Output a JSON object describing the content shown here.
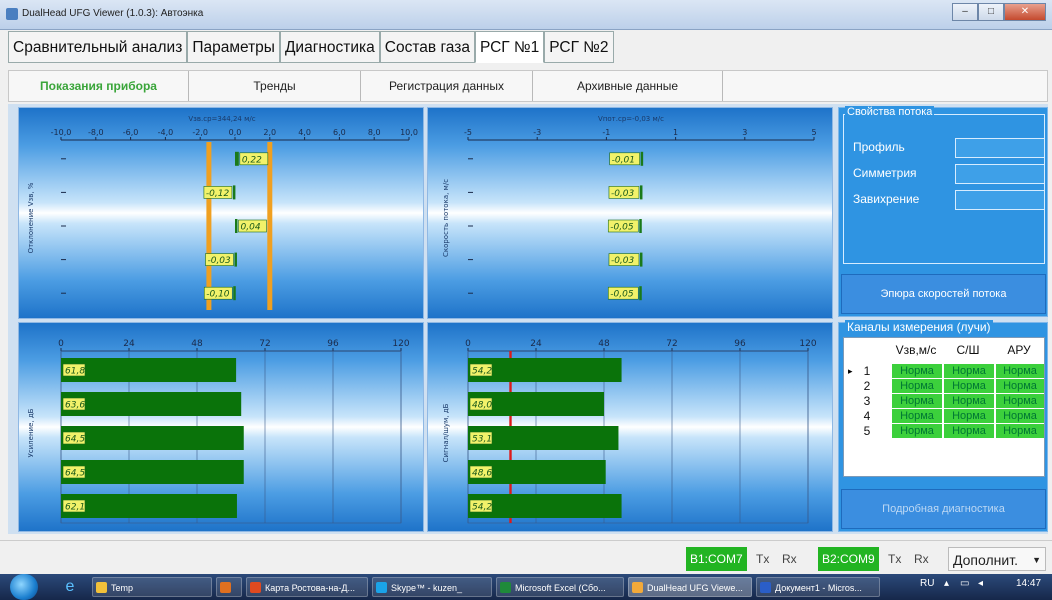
{
  "window": {
    "title": "DualHead UFG Viewer (1.0.3): Автоэнка",
    "btn_min": "–",
    "btn_max": "□",
    "btn_close": "✕"
  },
  "main_tabs": [
    {
      "label": "Сравнительный анализ"
    },
    {
      "label": "Параметры"
    },
    {
      "label": "Диагностика"
    },
    {
      "label": "Состав газа"
    },
    {
      "label": "РСГ №1",
      "active": true
    },
    {
      "label": "РСГ №2"
    }
  ],
  "sub_tabs": [
    {
      "label": "Показания прибора",
      "active": true
    },
    {
      "label": "Тренды"
    },
    {
      "label": "Регистрация данных"
    },
    {
      "label": "Архивные данные"
    }
  ],
  "charts": {
    "c1": {
      "title": "Vзв.ср=344,24 м/с",
      "ylabel": "Отклонение Vзв, %"
    },
    "c2": {
      "title": "Vпот.ср=-0,03 м/с",
      "ylabel": "Скорость потока, м/с"
    },
    "c3": {
      "ylabel": "Усиление, дБ"
    },
    "c4": {
      "ylabel": "Сигнал/шум, дБ"
    }
  },
  "chart_data": [
    {
      "type": "bar",
      "orientation": "horizontal",
      "title": "Vзв.ср=344,24 м/с",
      "ylabel": "Отклонение Vзв, %",
      "xticks": [
        "-10,0",
        "-8,0",
        "-6,0",
        "-4,0",
        "-2,0",
        "0,0",
        "2,0",
        "4,0",
        "6,0",
        "8,0",
        "10,0"
      ],
      "xlim": [
        -10,
        10
      ],
      "labels": [
        "0,22",
        "-0,12",
        "0,04",
        "-0,03",
        "-0,10"
      ],
      "values": [
        0.22,
        -0.12,
        0.04,
        -0.03,
        -0.1
      ],
      "limits": [
        -1.5,
        2.0
      ],
      "colors": {
        "bar": "#1a7a1a",
        "label": "#f2f26a",
        "limit": "#f0a020"
      }
    },
    {
      "type": "bar",
      "orientation": "horizontal",
      "title": "Vпот.ср=-0,03 м/с",
      "ylabel": "Скорость потока, м/с",
      "xticks": [
        "-5",
        "-3",
        "-1",
        "1",
        "3",
        "5"
      ],
      "xlim": [
        -5,
        5
      ],
      "labels": [
        "-0,01",
        "-0,03",
        "-0,05",
        "-0,03",
        "-0,05"
      ],
      "values": [
        -0.01,
        -0.03,
        -0.05,
        -0.03,
        -0.05
      ],
      "colors": {
        "bar": "#1a7a1a",
        "label": "#f2f26a"
      }
    },
    {
      "type": "bar",
      "orientation": "horizontal",
      "ylabel": "Усиление, дБ",
      "xticks": [
        "0",
        "24",
        "48",
        "72",
        "96",
        "120"
      ],
      "xlim": [
        0,
        120
      ],
      "labels": [
        "61,8",
        "63,6",
        "64,5",
        "64,5",
        "62,1"
      ],
      "values": [
        61.8,
        63.6,
        64.5,
        64.5,
        62.1
      ],
      "colors": {
        "bar": "#0a730a",
        "label": "#f2f26a"
      }
    },
    {
      "type": "bar",
      "orientation": "horizontal",
      "ylabel": "Сигнал/шум, дБ",
      "xticks": [
        "0",
        "24",
        "48",
        "72",
        "96",
        "120"
      ],
      "xlim": [
        0,
        120
      ],
      "labels": [
        "54,2",
        "48,0",
        "53,1",
        "48,6",
        "54,2"
      ],
      "values": [
        54.2,
        48.0,
        53.1,
        48.6,
        54.2
      ],
      "threshold": 15,
      "colors": {
        "bar": "#0a730a",
        "label": "#f2f26a",
        "threshold": "#dd1a1a"
      }
    }
  ],
  "flow_props": {
    "legend": "Свойства потока",
    "items": [
      {
        "label": "Профиль"
      },
      {
        "label": "Симметрия"
      },
      {
        "label": "Завихрение"
      }
    ],
    "epure_button": "Эпюра скоростей потока"
  },
  "channels": {
    "legend": "Каналы измерения (лучи)",
    "headers": [
      "Vзв,м/с",
      "С/Ш",
      "АРУ"
    ],
    "rows": [
      {
        "idx": "1",
        "cells": [
          "Норма",
          "Норма",
          "Норма"
        ]
      },
      {
        "idx": "2",
        "cells": [
          "Норма",
          "Норма",
          "Норма"
        ]
      },
      {
        "idx": "3",
        "cells": [
          "Норма",
          "Норма",
          "Норма"
        ]
      },
      {
        "idx": "4",
        "cells": [
          "Норма",
          "Норма",
          "Норма"
        ]
      },
      {
        "idx": "5",
        "cells": [
          "Норма",
          "Норма",
          "Норма"
        ]
      }
    ],
    "diag_button": "Подробная диагностика"
  },
  "status": {
    "com1": "B1:COM7",
    "tx1": "Tx",
    "rx1": "Rx",
    "com2": "B2:COM9",
    "tx2": "Tx",
    "rx2": "Rx",
    "more": "Дополнит."
  },
  "taskbar": {
    "items": [
      "Temp",
      "",
      "Карта Ростова-на-Д...",
      "Skype™ - kuzen_",
      "Microsoft Excel (Сбо...",
      "DualHead UFG Viewe...",
      "Документ1 - Micros..."
    ],
    "lang": "RU",
    "time": "14:47"
  }
}
